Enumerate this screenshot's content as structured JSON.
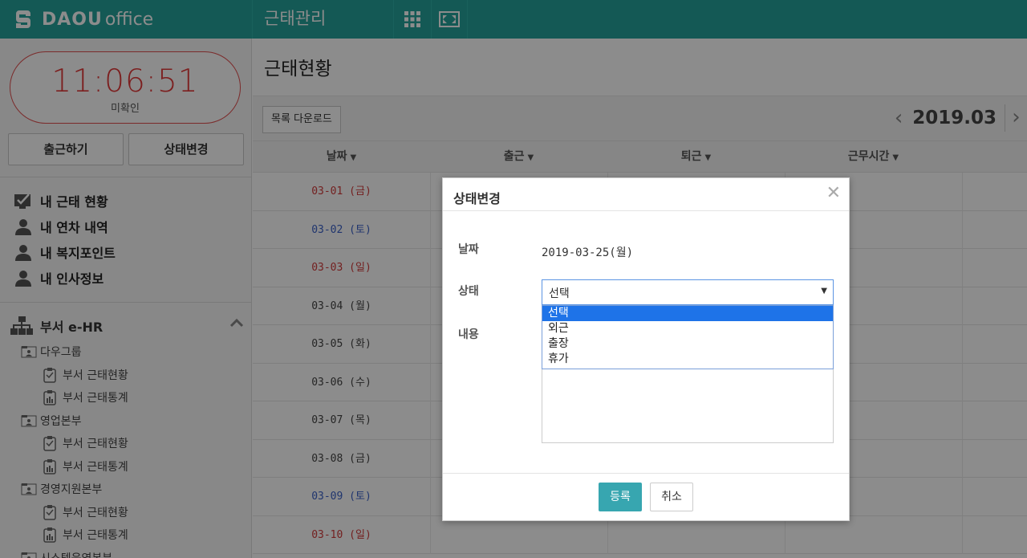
{
  "topbar": {
    "logo_bold": "DAOU",
    "logo_light": "office",
    "app_title": "근태관리",
    "apps_icon": "apps-grid-icon",
    "fullscreen_icon": "fullscreen-icon"
  },
  "sidebar": {
    "clock_time": "11:06:51",
    "clock_status": "미확인",
    "btn_clock_in": "출근하기",
    "btn_status_change": "상태변경",
    "my_menu": [
      {
        "label": "내 근태 현황",
        "icon": "checkbox-monitor-icon"
      },
      {
        "label": "내 연차 내역",
        "icon": "person-icon"
      },
      {
        "label": "내 복지포인트",
        "icon": "person-icon"
      },
      {
        "label": "내 인사정보",
        "icon": "person-icon"
      }
    ],
    "dept_title": "부서 e-HR",
    "tree": [
      {
        "type": "org",
        "label": "다우그룹"
      },
      {
        "type": "leaf",
        "label": "부서 근태현황"
      },
      {
        "type": "leaf",
        "label": "부서 근태통계"
      },
      {
        "type": "org",
        "label": "영업본부"
      },
      {
        "type": "leaf",
        "label": "부서 근태현황"
      },
      {
        "type": "leaf",
        "label": "부서 근태통계"
      },
      {
        "type": "org",
        "label": "경영지원본부"
      },
      {
        "type": "leaf",
        "label": "부서 근태현황"
      },
      {
        "type": "leaf",
        "label": "부서 근태통계"
      },
      {
        "type": "org",
        "label": "시스템운영본부"
      }
    ]
  },
  "main": {
    "page_title": "근태현황",
    "btn_download": "목록 다운로드",
    "month": "2019.03",
    "columns": [
      "날짜",
      "출근",
      "퇴근",
      "근무시간"
    ],
    "rows": [
      {
        "date": "03-01 (금)",
        "color": "#d23b3b"
      },
      {
        "date": "03-02 (토)",
        "color": "#3b62c9"
      },
      {
        "date": "03-03 (일)",
        "color": "#d23b3b"
      },
      {
        "date": "03-04 (월)",
        "color": "#444444"
      },
      {
        "date": "03-05 (화)",
        "color": "#444444"
      },
      {
        "date": "03-06 (수)",
        "color": "#444444"
      },
      {
        "date": "03-07 (목)",
        "color": "#444444"
      },
      {
        "date": "03-08 (금)",
        "color": "#444444"
      },
      {
        "date": "03-09 (토)",
        "color": "#3b62c9"
      },
      {
        "date": "03-10 (일)",
        "color": "#d23b3b"
      }
    ]
  },
  "modal": {
    "title": "상태변경",
    "label_date": "날짜",
    "date_value": "2019-03-25(월)",
    "label_status": "상태",
    "status_selected": "선택",
    "options": [
      "선택",
      "외근",
      "출장",
      "휴가"
    ],
    "label_content": "내용",
    "btn_register": "등록",
    "btn_cancel": "취소"
  },
  "colors": {
    "brand": "#26a39b",
    "clock_red": "#e23a3a",
    "weekend_blue": "#3b62c9",
    "register_button": "#37a6b0",
    "dropdown_highlight": "#1e73e8"
  }
}
